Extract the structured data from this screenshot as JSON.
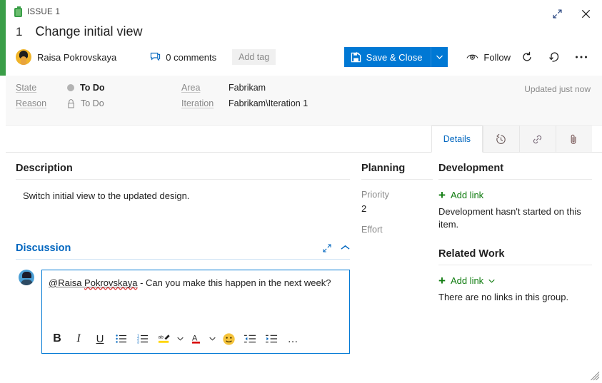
{
  "window": {
    "breadcrumb": "ISSUE 1",
    "maximize_title": "Maximize",
    "close_title": "Close"
  },
  "header": {
    "work_item_id": "1",
    "title": "Change initial view",
    "assignee": "Raisa Pokrovskaya",
    "comments_label": "0 comments",
    "add_tag_label": "Add tag",
    "save_label": "Save & Close",
    "follow_label": "Follow",
    "refresh_title": "Refresh",
    "undo_title": "Undo",
    "more_title": "More actions"
  },
  "fields": {
    "state_label": "State",
    "state_value": "To Do",
    "reason_label": "Reason",
    "reason_value": "To Do",
    "area_label": "Area",
    "area_value": "Fabrikam",
    "iteration_label": "Iteration",
    "iteration_value": "Fabrikam\\Iteration 1",
    "updated_text": "Updated just now"
  },
  "tabs": [
    {
      "label": "Details",
      "icon": "details",
      "active": true
    },
    {
      "label": "",
      "icon": "history-icon",
      "active": false
    },
    {
      "label": "",
      "icon": "link-icon",
      "active": false
    },
    {
      "label": "",
      "icon": "attachment-icon",
      "active": false
    }
  ],
  "description": {
    "heading": "Description",
    "text": "Switch initial view to the updated design."
  },
  "discussion": {
    "heading": "Discussion",
    "comment_mention": "@Raisa Pokrovskaya",
    "comment_rest": " - Can you make this happen in the next week?",
    "toolbar": [
      {
        "name": "bold-button",
        "label": "B"
      },
      {
        "name": "italic-button",
        "label": "I"
      },
      {
        "name": "underline-button",
        "label": "U"
      },
      {
        "name": "bulleted-list-button",
        "label": ""
      },
      {
        "name": "numbered-list-button",
        "label": ""
      },
      {
        "name": "highlight-button",
        "label": ""
      },
      {
        "name": "font-color-button",
        "label": "A"
      },
      {
        "name": "emoji-button",
        "label": ""
      },
      {
        "name": "decrease-indent-button",
        "label": ""
      },
      {
        "name": "increase-indent-button",
        "label": ""
      },
      {
        "name": "more-formatting-button",
        "label": "…"
      }
    ]
  },
  "planning": {
    "heading": "Planning",
    "priority_label": "Priority",
    "priority_value": "2",
    "effort_label": "Effort",
    "effort_value": ""
  },
  "development": {
    "heading": "Development",
    "add_link_label": "Add link",
    "note": "Development hasn't started on this item."
  },
  "related_work": {
    "heading": "Related Work",
    "add_link_label": "Add link",
    "note": "There are no links in this group."
  },
  "colors": {
    "accent_green": "#3a9e48",
    "primary_blue": "#0078d4",
    "link_blue": "#0066bf",
    "add_link_green": "#107c10",
    "field_strip_bg": "#f8f8f8"
  }
}
